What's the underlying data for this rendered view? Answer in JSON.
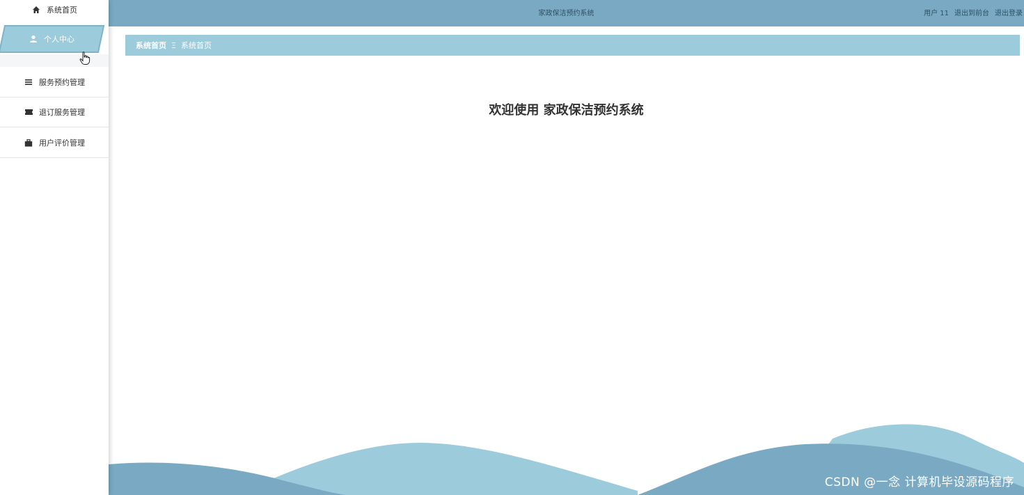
{
  "app": {
    "title": "家政保洁预约系统"
  },
  "topbar": {
    "user": "用户 11",
    "to_front": "退出到前台",
    "logout": "退出登录"
  },
  "sidebar": {
    "items": [
      {
        "label": "系统首页",
        "icon": "home-icon"
      },
      {
        "label": "个人中心",
        "icon": "user-icon",
        "active": true
      },
      {
        "label": "服务预约管理",
        "icon": "list-icon"
      },
      {
        "label": "退订服务管理",
        "icon": "ticket-icon"
      },
      {
        "label": "用户评价管理",
        "icon": "briefcase-icon"
      }
    ]
  },
  "breadcrumb": {
    "first": "系统首页",
    "separator": "Ξ",
    "second": "系统首页"
  },
  "main": {
    "welcome": "欢迎使用 家政保洁预约系统"
  },
  "watermark": "CSDN @一念 计算机毕设源码程序",
  "colors": {
    "accent": "#7aaac3",
    "accent_light": "#9ccbdb",
    "wave_dark": "#7aaac3",
    "wave_light": "#9ccbdb"
  }
}
